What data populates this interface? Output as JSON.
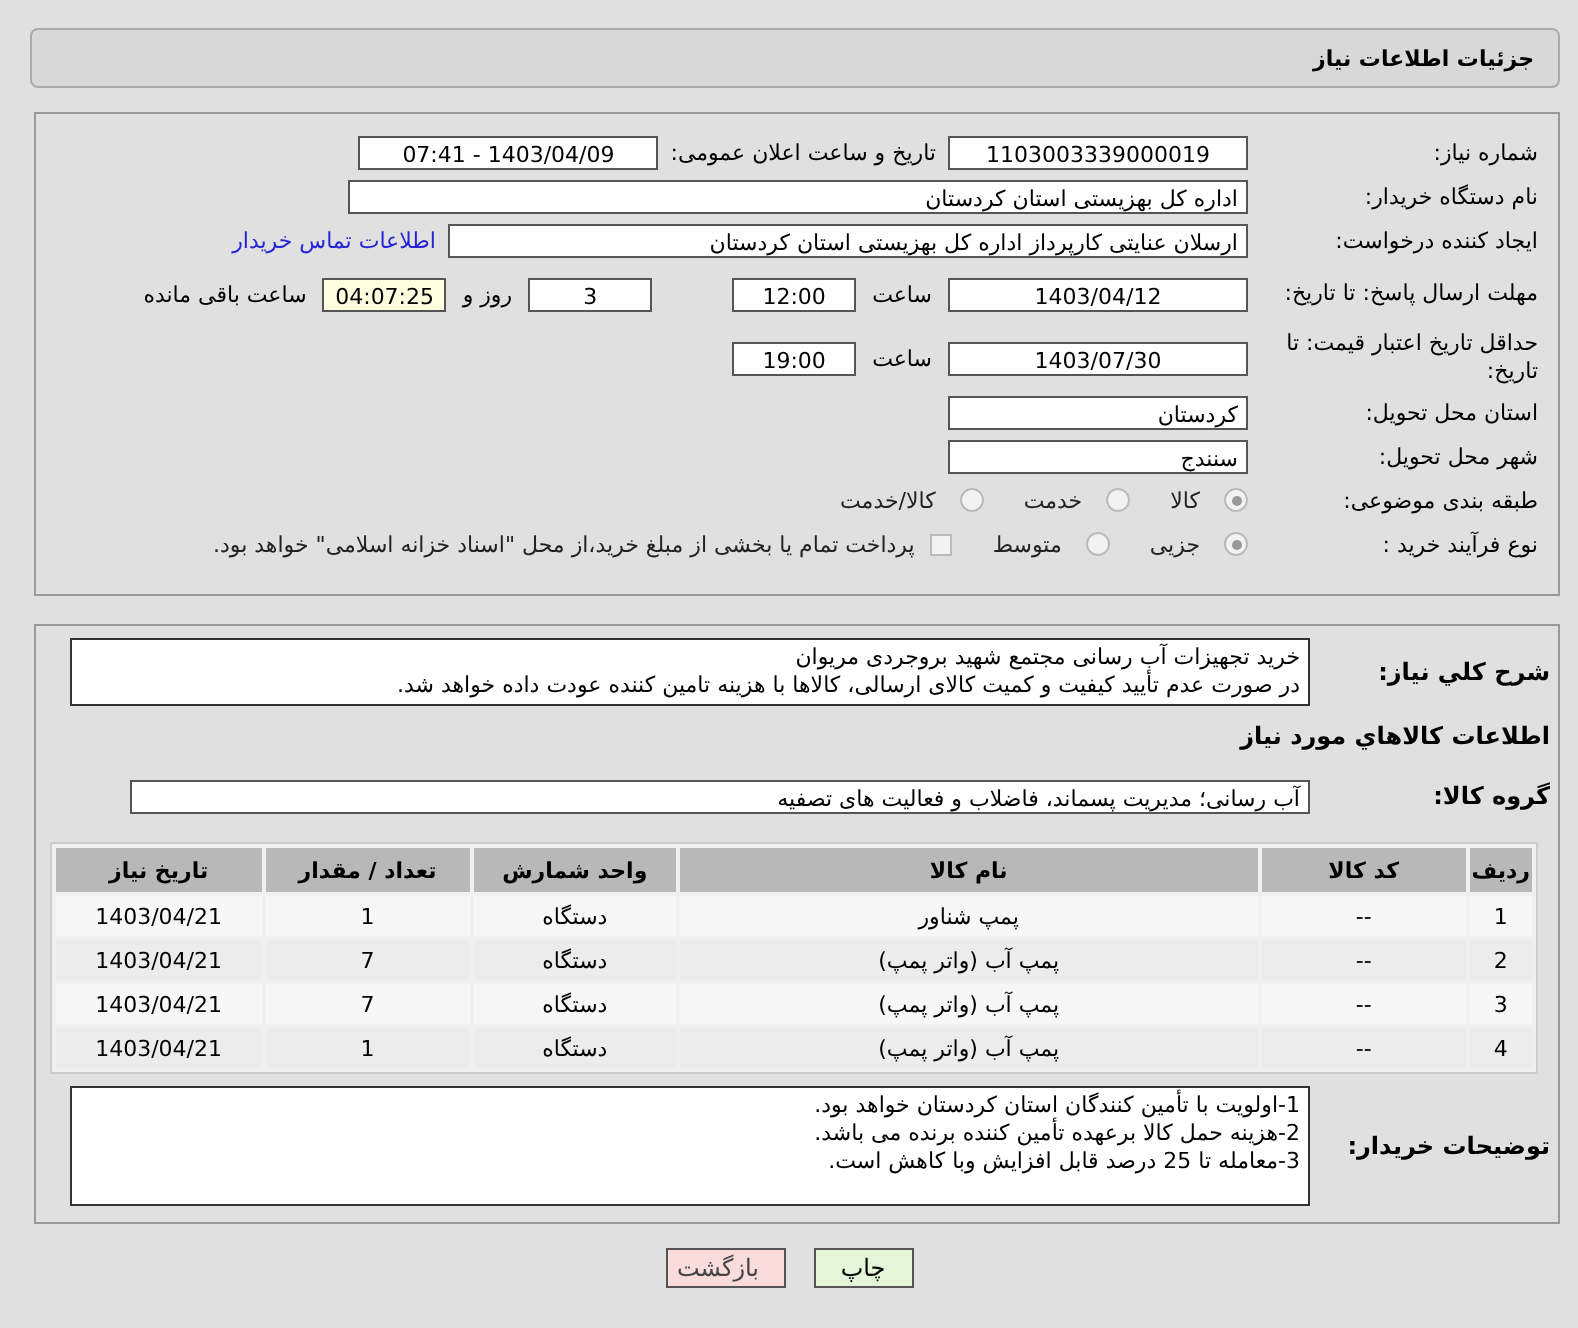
{
  "header": {
    "title": "جزئیات اطلاعات نیاز"
  },
  "need_number": {
    "label": "شماره نیاز:",
    "value": "1103003339000019"
  },
  "announce": {
    "label": "تاریخ و ساعت اعلان عمومی:",
    "value": "1403/04/09 - 07:41"
  },
  "buyer_org": {
    "label": "نام دستگاه خریدار:",
    "value": "اداره کل بهزیستی استان کردستان"
  },
  "requester": {
    "label": "ایجاد کننده درخواست:",
    "value": "ارسلان  عنایتی کارپرداز اداره کل بهزیستی استان کردستان",
    "link": "اطلاعات تماس خریدار"
  },
  "deadline": {
    "label": "مهلت ارسال پاسخ: تا تاریخ:",
    "date": "1403/04/12",
    "time_label": "ساعت",
    "time": "12:00",
    "days": "3",
    "days_label": "روز و",
    "remaining": "04:07:25",
    "remaining_label": "ساعت باقی مانده"
  },
  "validity": {
    "label": "حداقل تاریخ اعتبار قیمت: تا تاریخ:",
    "date": "1403/07/30",
    "time_label": "ساعت",
    "time": "19:00"
  },
  "province": {
    "label": "استان محل تحویل:",
    "value": "کردستان"
  },
  "city": {
    "label": "شهر محل تحویل:",
    "value": "سنندج"
  },
  "category": {
    "label": "طبقه بندی موضوعی:",
    "options": [
      {
        "label": "کالا",
        "selected": true
      },
      {
        "label": "خدمت",
        "selected": false
      },
      {
        "label": "کالا/خدمت",
        "selected": false
      }
    ]
  },
  "process": {
    "label": "نوع فرآیند خرید :",
    "options": [
      {
        "label": "جزیی",
        "selected": true
      },
      {
        "label": "متوسط",
        "selected": false
      }
    ],
    "payment": {
      "label": "پرداخت تمام یا بخشی از مبلغ خرید،از محل \"اسناد خزانه اسلامی\" خواهد بود.",
      "checked": false
    }
  },
  "description": {
    "label": "شرح کلي نياز:",
    "lines": [
      "خرید تجهیزات آب رسانی مجتمع شهید بروجردی مریوان",
      "در صورت عدم تأیید کیفیت و کمیت کالای ارسالی، کالاها با هزینه تامین کننده عودت داده خواهد شد."
    ]
  },
  "goods_title": "اطلاعات کالاهاي مورد نياز",
  "goods_group": {
    "label": "گروه کالا:",
    "value": "آب رسانی؛ مدیریت پسماند، فاضلاب و فعالیت های تصفیه"
  },
  "table": {
    "columns": [
      "ردیف",
      "کد کالا",
      "نام کالا",
      "واحد شمارش",
      "تعداد / مقدار",
      "تاریخ نیاز"
    ],
    "rows": [
      [
        "1",
        "--",
        "پمپ شناور",
        "دستگاه",
        "1",
        "1403/04/21"
      ],
      [
        "2",
        "--",
        "پمپ آب (واتر پمپ)",
        "دستگاه",
        "7",
        "1403/04/21"
      ],
      [
        "3",
        "--",
        "پمپ آب (واتر پمپ)",
        "دستگاه",
        "7",
        "1403/04/21"
      ],
      [
        "4",
        "--",
        "پمپ آب (واتر پمپ)",
        "دستگاه",
        "1",
        "1403/04/21"
      ]
    ]
  },
  "buyer_notes": {
    "label": "توضیحات خریدار:",
    "lines": [
      "1-اولویت با تأمین کنندگان استان کردستان خواهد بود.",
      "2-هزینه حمل کالا برعهده تأمین کننده برنده می باشد.",
      "3-معامله تا 25 درصد قابل افزایش وبا کاهش است."
    ]
  },
  "buttons": [
    {
      "label": "چاپ",
      "kind": "print"
    },
    {
      "label": "بازگشت",
      "kind": "back"
    }
  ]
}
